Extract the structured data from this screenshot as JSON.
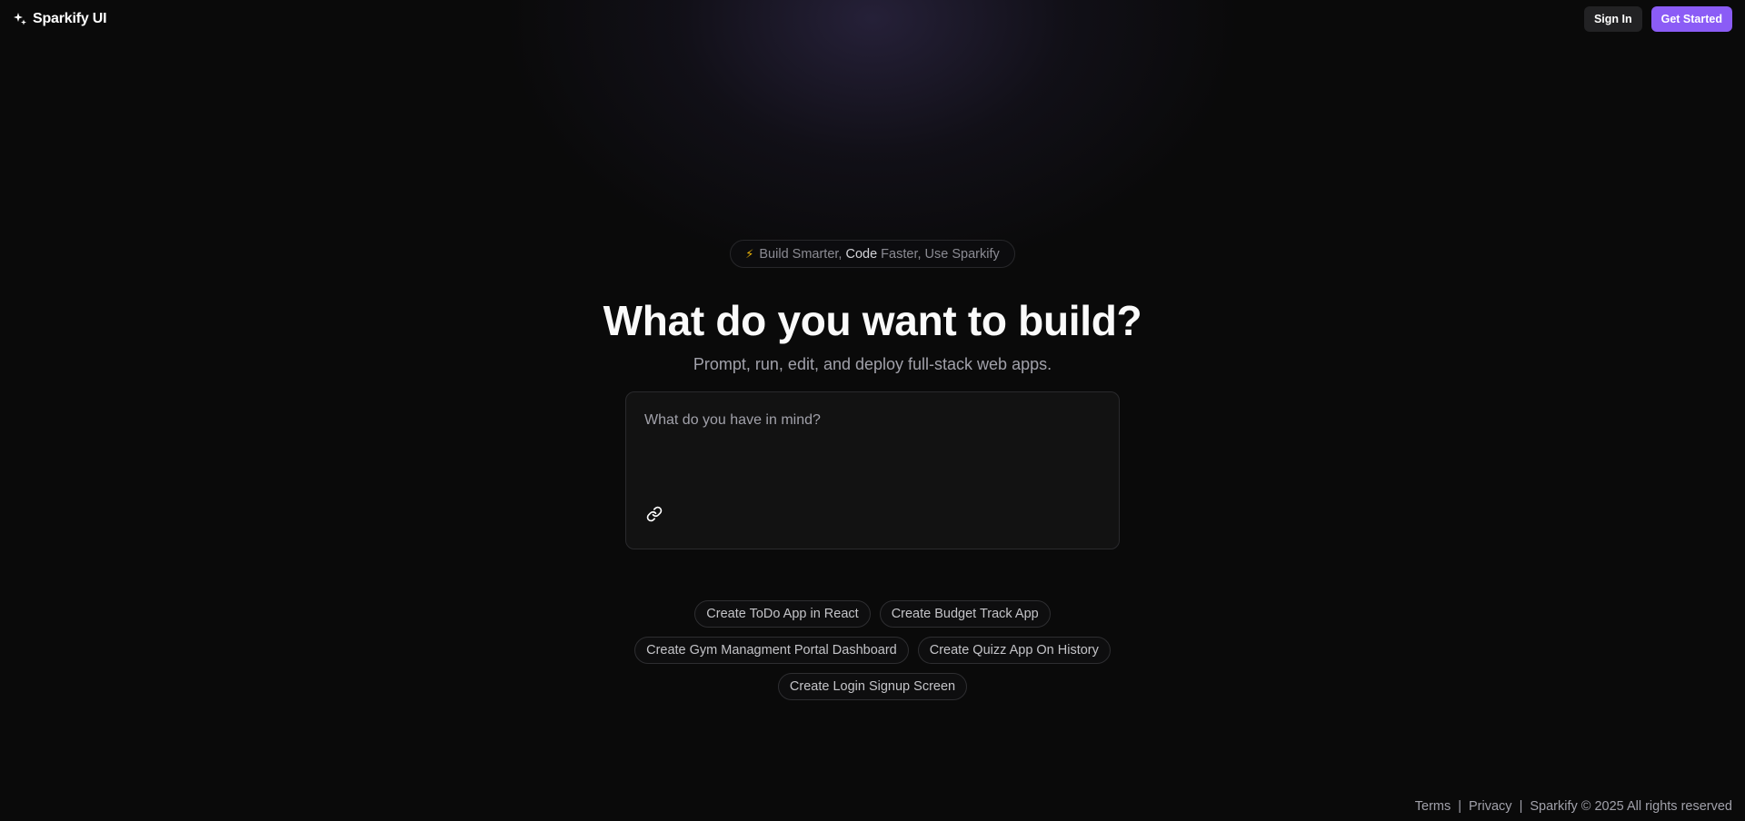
{
  "header": {
    "brand": "Sparkify UI",
    "sign_in": "Sign In",
    "get_started": "Get Started"
  },
  "hero": {
    "badge": {
      "part1": "Build Smarter, ",
      "part2": "Code",
      "part3": " Faster, Use Sparkify"
    },
    "title": "What do you want to build?",
    "subtitle": "Prompt, run, edit, and deploy full-stack web apps.",
    "prompt_placeholder": "What do you have in mind?"
  },
  "suggestions": [
    [
      "Create ToDo App in React",
      "Create Budget Track App"
    ],
    [
      "Create Gym Managment Portal Dashboard",
      "Create Quizz App On History"
    ],
    [
      "Create Login Signup Screen"
    ]
  ],
  "footer": {
    "terms": "Terms",
    "privacy": "Privacy",
    "copyright": "Sparkify © 2025 All rights reserved",
    "separator": "|"
  },
  "colors": {
    "background": "#0a0a0a",
    "accent": "#8b5cf6",
    "bolt": "#eab308"
  },
  "icons": {
    "brand": "sparkle-icon",
    "badge": "lightning-icon",
    "attach": "link-icon"
  }
}
